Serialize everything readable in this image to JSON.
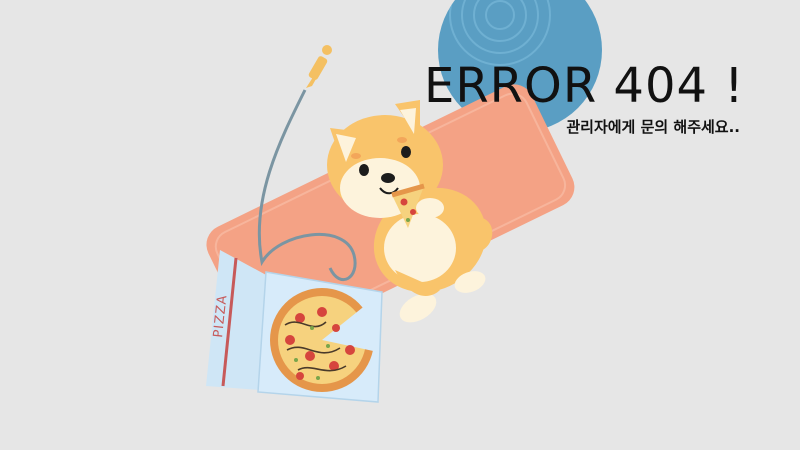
{
  "error": {
    "title": "ERROR 404 !",
    "message": "관리자에게 문의 해주세요.."
  },
  "illustration": {
    "box_label": "PIZZA",
    "icons": [
      "yoga-ball-icon",
      "yoga-mat-icon",
      "shiba-dog-icon",
      "pizza-box-icon",
      "pizza-icon",
      "pizza-slice-icon",
      "jump-rope-icon"
    ]
  },
  "colors": {
    "background": "#e6e6e6",
    "ball": "#5a9ec3",
    "mat": "#f4a285",
    "dog": "#f9c46b",
    "box": "#cfe6f6",
    "text": "#111111"
  }
}
